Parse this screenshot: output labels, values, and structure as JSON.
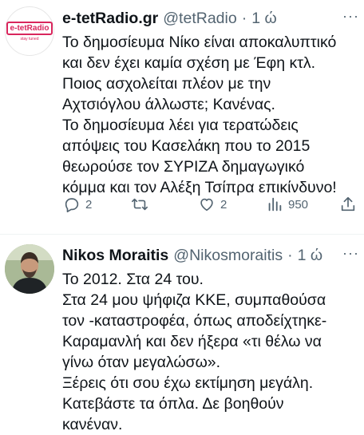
{
  "tweets": [
    {
      "display_name": "e-tetRadio.gr",
      "handle": "@tetRadio",
      "separator": "·",
      "time": "1 ώ",
      "avatar_logo_text": "e-tetRadio",
      "avatar_logo_tagline": "stay tuned",
      "lines": [
        "Το δημοσίευμα Νίκο είναι αποκαλυπτικό",
        "και δεν έχει καμία σχέση με Έφη κτλ.",
        "Ποιος ασχολείται πλέον με την",
        "Αχτσιόγλου άλλωστε; Κανένας.",
        "Το δημοσίευμα λέει για τερατώδεις",
        "απόψεις του Κασελάκη που το 2015",
        "θεωρούσε τον ΣΥΡΙΖΑ δημαγωγικό",
        "κόμμα και τον Αλέξη Τσίπρα επικίνδυνο!"
      ],
      "replies": "2",
      "retweets": "",
      "likes": "2",
      "views": "950"
    },
    {
      "display_name": "Nikos Moraitis",
      "handle": "@Nikosmoraitis",
      "separator": "·",
      "time": "1 ώ",
      "lines": [
        "Το 2012. Στα 24 του.",
        "Στα 24 μου ψήφιζα ΚΚΕ, συμπαθούσα",
        "τον -καταστροφέα, όπως αποδείχτηκε-",
        "Καραμανλή και δεν ήξερα «τι θέλω να",
        "γίνω όταν μεγαλώσω».",
        "Ξέρεις ότι σου έχω εκτίμηση μεγάλη.",
        "Κατεβάστε τα όπλα. Δε βοηθούν",
        "κανέναν."
      ]
    }
  ],
  "colors": {
    "text": "#0f1419",
    "secondary": "#536471",
    "divider": "#eff3f4",
    "logo_pink": "#d9265d"
  },
  "icons": {
    "reply": "reply-icon",
    "retweet": "retweet-icon",
    "like": "heart-icon",
    "views": "views-icon",
    "share": "share-icon",
    "more": "more-icon"
  }
}
